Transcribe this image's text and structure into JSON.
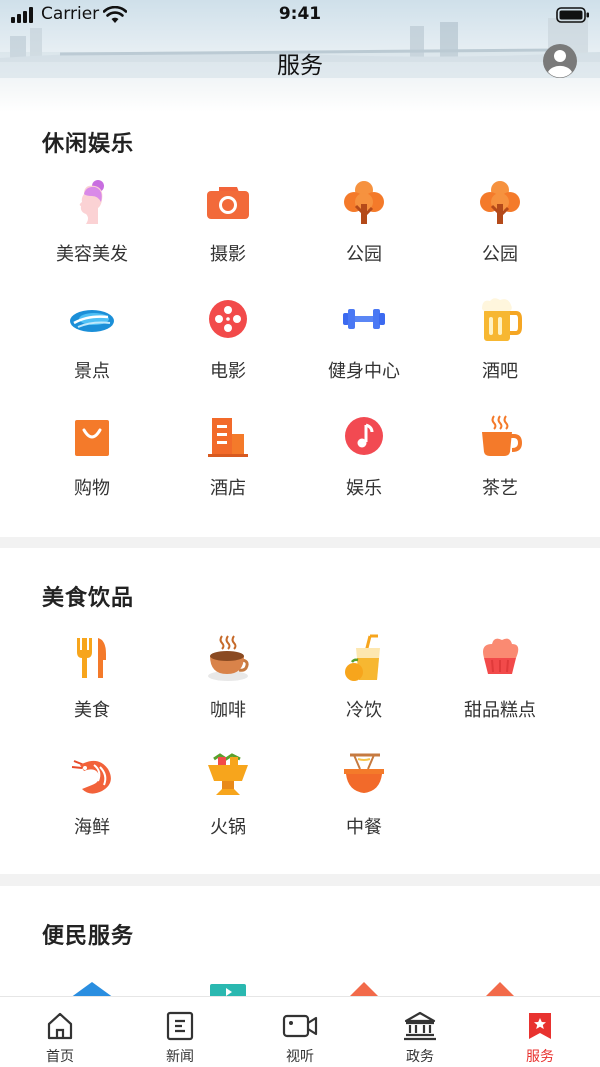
{
  "status_bar": {
    "carrier": "Carrier",
    "time": "9:41"
  },
  "header": {
    "title": "服务"
  },
  "sections": [
    {
      "title": "休闲娱乐",
      "items": [
        {
          "label": "美容美发",
          "icon": "beauty-icon"
        },
        {
          "label": "摄影",
          "icon": "camera-icon"
        },
        {
          "label": "公园",
          "icon": "park-tree-icon"
        },
        {
          "label": "公园",
          "icon": "park-tree-icon"
        },
        {
          "label": "景点",
          "icon": "scenic-icon"
        },
        {
          "label": "电影",
          "icon": "film-reel-icon"
        },
        {
          "label": "健身中心",
          "icon": "dumbbell-icon"
        },
        {
          "label": "酒吧",
          "icon": "beer-icon"
        },
        {
          "label": "购物",
          "icon": "shopping-bag-icon"
        },
        {
          "label": "酒店",
          "icon": "hotel-building-icon"
        },
        {
          "label": "娱乐",
          "icon": "music-note-icon"
        },
        {
          "label": "茶艺",
          "icon": "tea-cup-icon"
        }
      ]
    },
    {
      "title": "美食饮品",
      "items": [
        {
          "label": "美食",
          "icon": "fork-knife-icon"
        },
        {
          "label": "咖啡",
          "icon": "coffee-icon"
        },
        {
          "label": "冷饮",
          "icon": "cold-drink-icon"
        },
        {
          "label": "甜品糕点",
          "icon": "cupcake-icon"
        },
        {
          "label": "海鲜",
          "icon": "shrimp-icon"
        },
        {
          "label": "火锅",
          "icon": "hotpot-icon"
        },
        {
          "label": "中餐",
          "icon": "noodle-bowl-icon"
        }
      ]
    },
    {
      "title": "便民服务"
    }
  ],
  "tabs": [
    {
      "label": "首页",
      "icon": "home-icon",
      "active": false
    },
    {
      "label": "新闻",
      "icon": "news-icon",
      "active": false
    },
    {
      "label": "视听",
      "icon": "video-camera-icon",
      "active": false
    },
    {
      "label": "政务",
      "icon": "government-icon",
      "active": false
    },
    {
      "label": "服务",
      "icon": "service-bookmark-icon",
      "active": true
    }
  ],
  "colors": {
    "accent": "#e8322f",
    "orange": "#f47a2a",
    "background": "#f2f2f2"
  }
}
